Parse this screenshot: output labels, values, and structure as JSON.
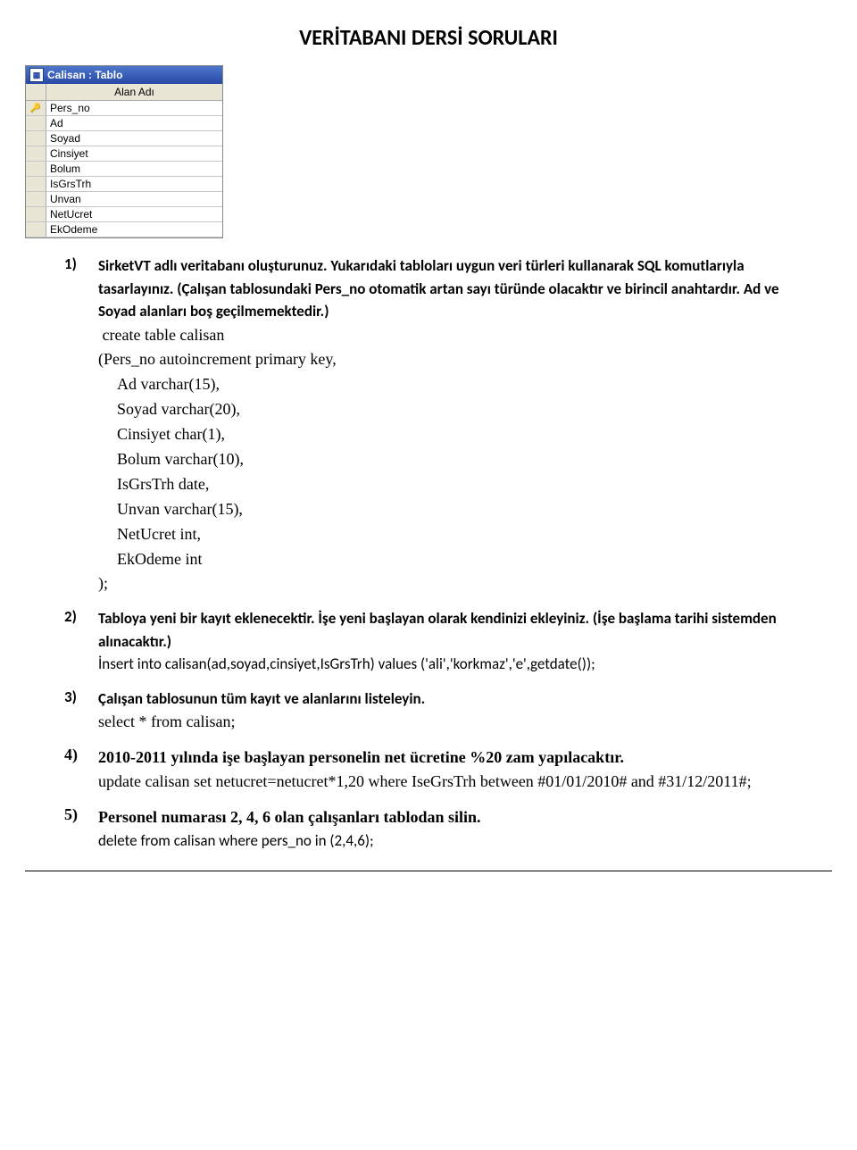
{
  "title": "VERİTABANI DERSİ SORULARI",
  "access": {
    "title": "Calisan : Tablo",
    "icon_text": "▦",
    "column_header": "Alan Adı",
    "rows": [
      {
        "name": "Pers_no",
        "is_key": true
      },
      {
        "name": "Ad",
        "is_key": false
      },
      {
        "name": "Soyad",
        "is_key": false
      },
      {
        "name": "Cinsiyet",
        "is_key": false
      },
      {
        "name": "Bolum",
        "is_key": false
      },
      {
        "name": "IsGrsTrh",
        "is_key": false
      },
      {
        "name": "Unvan",
        "is_key": false
      },
      {
        "name": "NetUcret",
        "is_key": false
      },
      {
        "name": "EkOdeme",
        "is_key": false
      }
    ]
  },
  "q1": {
    "num": "1)",
    "text": "SirketVT adlı veritabanı oluşturunuz. Yukarıdaki tabloları uygun veri türleri kullanarak SQL komutlarıyla tasarlayınız. (Çalışan tablosundaki Pers_no  otomatik artan sayı türünde olacaktır ve birincil anahtardır. Ad ve Soyad alanları boş geçilmemektedir.)",
    "code": [
      " create table calisan",
      "(Pers_no autoincrement primary key,",
      "  Ad varchar(15),",
      "  Soyad varchar(20),",
      "  Cinsiyet char(1),",
      "  Bolum varchar(10),",
      "  IsGrsTrh date,",
      "  Unvan varchar(15),",
      "  NetUcret int,",
      "  EkOdeme int",
      ");"
    ]
  },
  "q2": {
    "num": "2)",
    "text": "Tabloya yeni bir kayıt eklenecektir. İşe yeni başlayan olarak kendinizi ekleyiniz. (İşe başlama tarihi sistemden alınacaktır.)",
    "ans": "İnsert into calisan(ad,soyad,cinsiyet,IsGrsTrh) values ('ali','korkmaz','e',getdate());"
  },
  "q3": {
    "num": "3)",
    "text": "Çalışan tablosunun tüm kayıt ve alanlarını listeleyin.",
    "ans": "select * from calisan;"
  },
  "q4": {
    "num": "4)",
    "text": "2010-2011 yılında işe başlayan personelin net ücretine %20 zam yapılacaktır.",
    "ans": "update calisan set netucret=netucret*1,20 where IseGrsTrh between  #01/01/2010# and #31/12/2011#;"
  },
  "q5": {
    "num": "5)",
    "text": "Personel numarası 2, 4, 6 olan çalışanları tablodan silin.",
    "ans": "delete from calisan where pers_no in (2,4,6);"
  },
  "key_glyph": "🔑"
}
